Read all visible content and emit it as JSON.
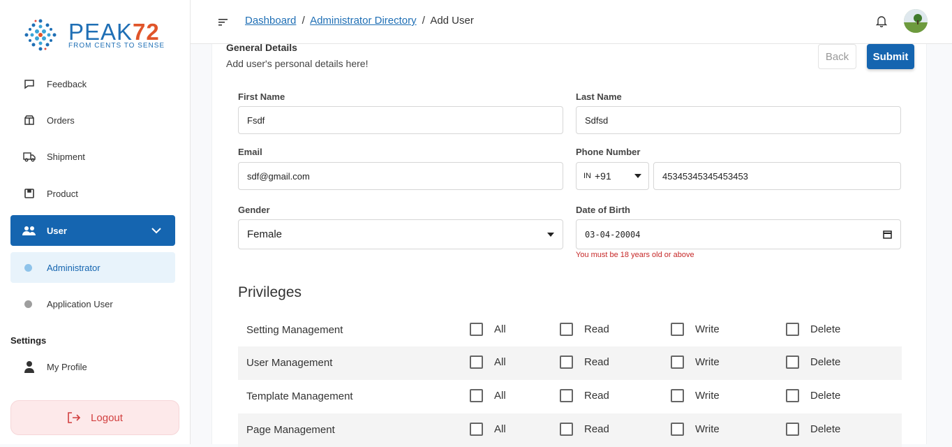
{
  "brand": {
    "name": "PEAK",
    "name_num": "72",
    "tagline": "FROM CENTS TO SENSE"
  },
  "sidebar": {
    "items": [
      {
        "label": "Feedback",
        "icon": "chat-icon"
      },
      {
        "label": "Orders",
        "icon": "box-open-icon"
      },
      {
        "label": "Shipment",
        "icon": "truck-icon"
      },
      {
        "label": "Product",
        "icon": "package-icon"
      },
      {
        "label": "User",
        "icon": "users-icon"
      },
      {
        "label": "Administrator"
      },
      {
        "label": "Application User"
      }
    ],
    "settings_title": "Settings",
    "my_profile": "My Profile",
    "logout": "Logout"
  },
  "header": {
    "crumb_1": "Dashboard",
    "crumb_2": "Administrator Directory",
    "crumb_3": "Add User",
    "sep": "/"
  },
  "form": {
    "title": "General Details",
    "subtitle": "Add user's personal details here!",
    "back": "Back",
    "submit": "Submit",
    "first_name_label": "First Name",
    "first_name": "Fsdf",
    "last_name_label": "Last Name",
    "last_name": "Sdfsd",
    "email_label": "Email",
    "email": "sdf@gmail.com",
    "phone_label": "Phone Number",
    "country_code": "IN",
    "dial_code": "+91",
    "phone": "45345345345453453",
    "gender_label": "Gender",
    "gender": "Female",
    "dob_label": "Date of Birth",
    "dob": "03-04-20004",
    "dob_error": "You must be 18 years old or above"
  },
  "privileges": {
    "title": "Privileges",
    "cols": [
      "All",
      "Read",
      "Write",
      "Delete"
    ],
    "rows": [
      "Setting Management",
      "User Management",
      "Template Management",
      "Page Management"
    ]
  },
  "colors": {
    "primary": "#1565b0",
    "error": "#c62828",
    "logout_bg": "#fde9ea"
  }
}
